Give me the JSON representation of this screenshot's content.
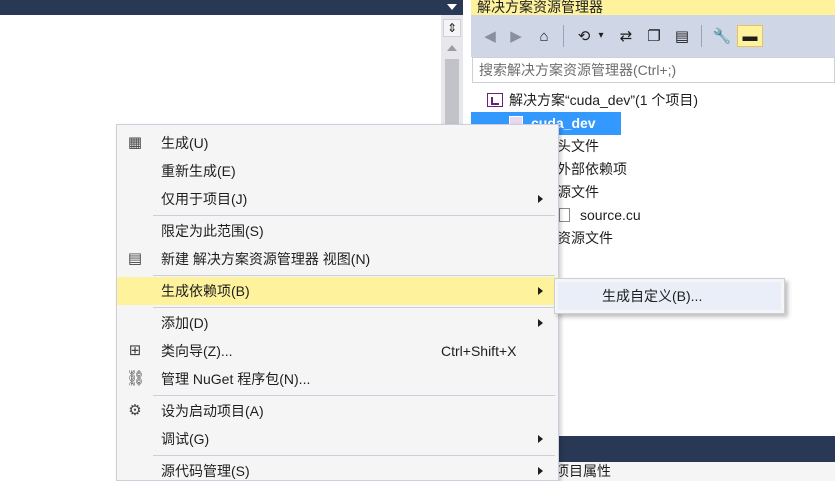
{
  "solution_explorer": {
    "title": "解决方案资源管理器",
    "search_placeholder": "搜索解决方案资源管理器(Ctrl+;)",
    "toolbar_icons": [
      "back-icon",
      "forward-icon",
      "home-icon",
      "history-icon",
      "sync-icon",
      "collapse-all-icon",
      "show-all-files-icon",
      "properties-icon",
      "preview-icon"
    ],
    "tree": {
      "solution": "解决方案“cuda_dev”(1 个项目)",
      "project": "cuda_dev",
      "headers": "头文件",
      "external_deps": "外部依赖项",
      "source_files": "源文件",
      "source_file": "source.cu",
      "resource_files": "资源文件"
    },
    "bottom_text": "项目属性"
  },
  "context_menu": {
    "items": [
      {
        "label": "生成(U)",
        "icon": "build-icon"
      },
      {
        "label": "重新生成(E)"
      },
      {
        "label": "仅用于项目(J)",
        "submenu": true
      },
      {
        "label": "限定为此范围(S)"
      },
      {
        "label": "新建 解决方案资源管理器 视图(N)",
        "icon": "new-view-icon"
      },
      {
        "label": "生成依赖项(B)",
        "submenu": true,
        "highlighted": true
      },
      {
        "label": "添加(D)",
        "submenu": true
      },
      {
        "label": "类向导(Z)...",
        "shortcut": "Ctrl+Shift+X",
        "icon": "class-wizard-icon"
      },
      {
        "label": "管理 NuGet 程序包(N)...",
        "icon": "nuget-icon"
      },
      {
        "label": "设为启动项目(A)",
        "icon": "gear-icon"
      },
      {
        "label": "调试(G)",
        "submenu": true
      },
      {
        "label": "源代码管理(S)",
        "submenu": true
      }
    ]
  },
  "submenu": {
    "items": [
      {
        "label": "生成自定义(B)..."
      }
    ]
  },
  "colors": {
    "title_bar_dark": "#293955",
    "highlight_yellow": "#fff29d",
    "selection_blue": "#3399ff",
    "menu_background": "#f5f5f5"
  }
}
